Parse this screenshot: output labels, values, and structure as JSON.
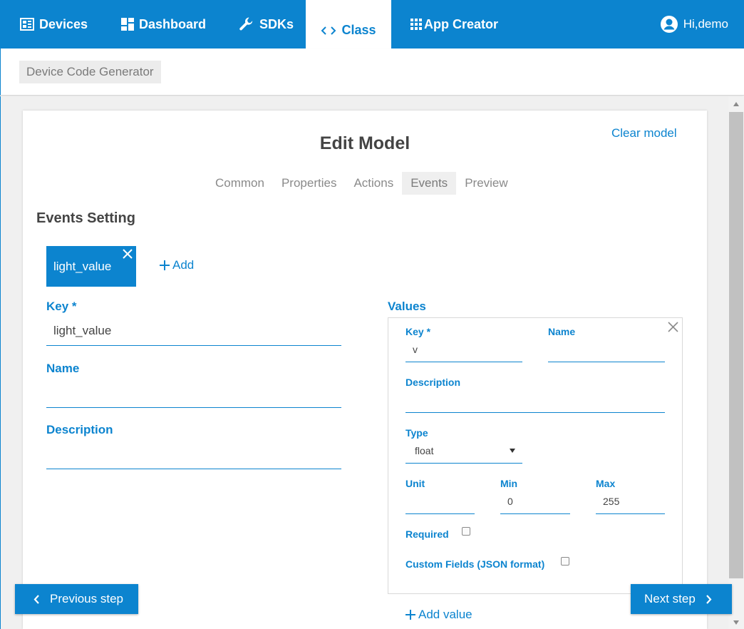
{
  "nav": {
    "devices": "Devices",
    "dashboard": "Dashboard",
    "sdks": "SDKs",
    "class": "Class",
    "app_creator": "App Creator",
    "user": "Hi,demo"
  },
  "breadcrumb": "Device Code Generator",
  "page": {
    "title": "Edit Model",
    "clear_model": "Clear model",
    "tabs": [
      "Common",
      "Properties",
      "Actions",
      "Events",
      "Preview"
    ],
    "active_tab": "Events",
    "section_title": "Events Setting"
  },
  "event": {
    "chip_label": "light_value",
    "add_label": "Add",
    "key_label": "Key *",
    "key_value": "light_value",
    "name_label": "Name",
    "name_value": "",
    "description_label": "Description",
    "description_value": ""
  },
  "values": {
    "heading": "Values",
    "key_label": "Key *",
    "key_value": "v",
    "name_label": "Name",
    "name_value": "",
    "description_label": "Description",
    "description_value": "",
    "type_label": "Type",
    "type_value": "float",
    "unit_label": "Unit",
    "unit_value": "",
    "min_label": "Min",
    "min_value": "0",
    "max_label": "Max",
    "max_value": "255",
    "required_label": "Required",
    "required_checked": false,
    "custom_fields_label": "Custom Fields (JSON format)",
    "custom_fields_checked": false,
    "add_value_label": "Add value"
  },
  "buttons": {
    "previous": "Previous step",
    "next": "Next step"
  },
  "colors": {
    "primary": "#0c84cf",
    "background": "#f0f0f0"
  }
}
